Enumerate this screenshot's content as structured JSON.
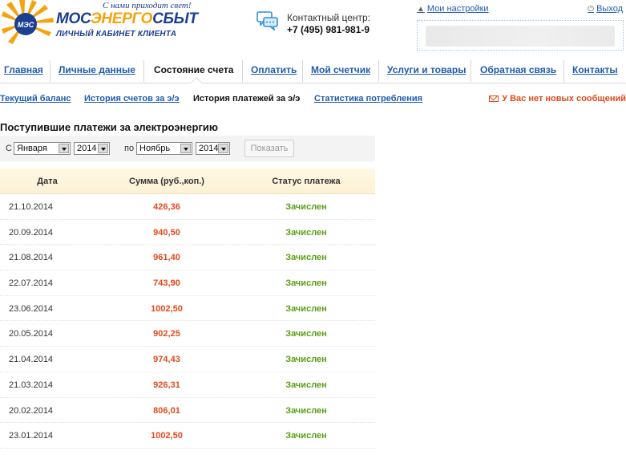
{
  "brand": {
    "slogan": "С нами приходит свет!",
    "name_part1": "МОС",
    "name_part2": "ЭНЕРГО",
    "name_part3": "СБЫТ",
    "subtitle": "ЛИЧНЫЙ КАБИНЕТ КЛИЕНТА",
    "emblem_text": "МЭС"
  },
  "contact": {
    "label": "Контактный центр:",
    "phone": "+7 (495) 981-981-9"
  },
  "user": {
    "settings_label": "Мои настройки",
    "logout_label": "Выход"
  },
  "nav": {
    "items": [
      {
        "label": "Главная"
      },
      {
        "label": "Личные данные"
      },
      {
        "label": "Состояние счета"
      },
      {
        "label": "Оплатить"
      },
      {
        "label": "Мой счетчик"
      },
      {
        "label": "Услуги и товары"
      },
      {
        "label": "Обратная связь"
      },
      {
        "label": "Контакты"
      }
    ],
    "active": "Состояние счета"
  },
  "subnav": {
    "items": [
      {
        "label": "Текущий баланс"
      },
      {
        "label": "История счетов за э/э"
      },
      {
        "label": "История платежей за э/э"
      },
      {
        "label": "Статистика потребления"
      }
    ],
    "active": "История платежей за э/э",
    "messages": "У Вас нет новых сообщений"
  },
  "section_title": "Поступившие платежи за электроэнергию",
  "filter": {
    "from_label": "С",
    "from_month": "Января",
    "from_year": "2014",
    "to_label": "по",
    "to_month": "Ноябрь",
    "to_year": "2014",
    "show_button": "Показать"
  },
  "table": {
    "headers": {
      "date": "Дата",
      "sum": "Сумма (руб.,коп.)",
      "status": "Статус платежа"
    },
    "rows": [
      {
        "date": "21.10.2014",
        "sum": "426,36",
        "status": "Зачислен"
      },
      {
        "date": "20.09.2014",
        "sum": "940,50",
        "status": "Зачислен"
      },
      {
        "date": "21.08.2014",
        "sum": "961,40",
        "status": "Зачислен"
      },
      {
        "date": "22.07.2014",
        "sum": "743,90",
        "status": "Зачислен"
      },
      {
        "date": "23.06.2014",
        "sum": "1002,50",
        "status": "Зачислен"
      },
      {
        "date": "20.05.2014",
        "sum": "902,25",
        "status": "Зачислен"
      },
      {
        "date": "21.04.2014",
        "sum": "974,43",
        "status": "Зачислен"
      },
      {
        "date": "21.03.2014",
        "sum": "926,31",
        "status": "Зачислен"
      },
      {
        "date": "20.02.2014",
        "sum": "806,01",
        "status": "Зачислен"
      },
      {
        "date": "23.01.2014",
        "sum": "1002,50",
        "status": "Зачислен"
      }
    ]
  },
  "colors": {
    "link": "#1f5bb0",
    "brand_blue": "#1d3f8f",
    "brand_orange": "#f4a30c",
    "sum_red": "#e4491b",
    "status_green": "#5a9e15",
    "table_header_bg": "#fdf2d6"
  },
  "icons": {
    "settings": "user-settings-icon",
    "logout": "power-icon",
    "contact": "chat-bubbles-icon",
    "messages": "envelope-icon"
  }
}
